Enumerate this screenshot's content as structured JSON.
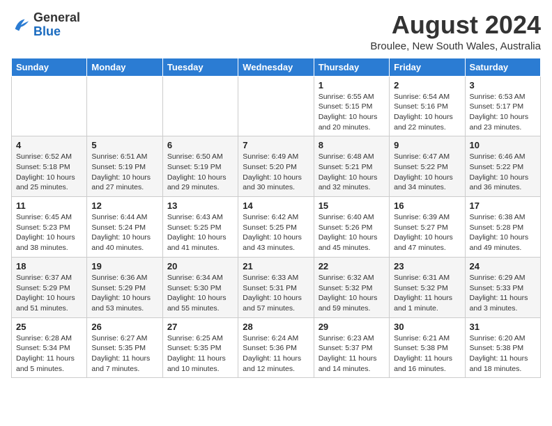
{
  "header": {
    "logo_general": "General",
    "logo_blue": "Blue",
    "month_title": "August 2024",
    "location": "Broulee, New South Wales, Australia"
  },
  "days_of_week": [
    "Sunday",
    "Monday",
    "Tuesday",
    "Wednesday",
    "Thursday",
    "Friday",
    "Saturday"
  ],
  "weeks": [
    [
      {
        "day": "",
        "info": ""
      },
      {
        "day": "",
        "info": ""
      },
      {
        "day": "",
        "info": ""
      },
      {
        "day": "",
        "info": ""
      },
      {
        "day": "1",
        "info": "Sunrise: 6:55 AM\nSunset: 5:15 PM\nDaylight: 10 hours\nand 20 minutes."
      },
      {
        "day": "2",
        "info": "Sunrise: 6:54 AM\nSunset: 5:16 PM\nDaylight: 10 hours\nand 22 minutes."
      },
      {
        "day": "3",
        "info": "Sunrise: 6:53 AM\nSunset: 5:17 PM\nDaylight: 10 hours\nand 23 minutes."
      }
    ],
    [
      {
        "day": "4",
        "info": "Sunrise: 6:52 AM\nSunset: 5:18 PM\nDaylight: 10 hours\nand 25 minutes."
      },
      {
        "day": "5",
        "info": "Sunrise: 6:51 AM\nSunset: 5:19 PM\nDaylight: 10 hours\nand 27 minutes."
      },
      {
        "day": "6",
        "info": "Sunrise: 6:50 AM\nSunset: 5:19 PM\nDaylight: 10 hours\nand 29 minutes."
      },
      {
        "day": "7",
        "info": "Sunrise: 6:49 AM\nSunset: 5:20 PM\nDaylight: 10 hours\nand 30 minutes."
      },
      {
        "day": "8",
        "info": "Sunrise: 6:48 AM\nSunset: 5:21 PM\nDaylight: 10 hours\nand 32 minutes."
      },
      {
        "day": "9",
        "info": "Sunrise: 6:47 AM\nSunset: 5:22 PM\nDaylight: 10 hours\nand 34 minutes."
      },
      {
        "day": "10",
        "info": "Sunrise: 6:46 AM\nSunset: 5:22 PM\nDaylight: 10 hours\nand 36 minutes."
      }
    ],
    [
      {
        "day": "11",
        "info": "Sunrise: 6:45 AM\nSunset: 5:23 PM\nDaylight: 10 hours\nand 38 minutes."
      },
      {
        "day": "12",
        "info": "Sunrise: 6:44 AM\nSunset: 5:24 PM\nDaylight: 10 hours\nand 40 minutes."
      },
      {
        "day": "13",
        "info": "Sunrise: 6:43 AM\nSunset: 5:25 PM\nDaylight: 10 hours\nand 41 minutes."
      },
      {
        "day": "14",
        "info": "Sunrise: 6:42 AM\nSunset: 5:25 PM\nDaylight: 10 hours\nand 43 minutes."
      },
      {
        "day": "15",
        "info": "Sunrise: 6:40 AM\nSunset: 5:26 PM\nDaylight: 10 hours\nand 45 minutes."
      },
      {
        "day": "16",
        "info": "Sunrise: 6:39 AM\nSunset: 5:27 PM\nDaylight: 10 hours\nand 47 minutes."
      },
      {
        "day": "17",
        "info": "Sunrise: 6:38 AM\nSunset: 5:28 PM\nDaylight: 10 hours\nand 49 minutes."
      }
    ],
    [
      {
        "day": "18",
        "info": "Sunrise: 6:37 AM\nSunset: 5:29 PM\nDaylight: 10 hours\nand 51 minutes."
      },
      {
        "day": "19",
        "info": "Sunrise: 6:36 AM\nSunset: 5:29 PM\nDaylight: 10 hours\nand 53 minutes."
      },
      {
        "day": "20",
        "info": "Sunrise: 6:34 AM\nSunset: 5:30 PM\nDaylight: 10 hours\nand 55 minutes."
      },
      {
        "day": "21",
        "info": "Sunrise: 6:33 AM\nSunset: 5:31 PM\nDaylight: 10 hours\nand 57 minutes."
      },
      {
        "day": "22",
        "info": "Sunrise: 6:32 AM\nSunset: 5:32 PM\nDaylight: 10 hours\nand 59 minutes."
      },
      {
        "day": "23",
        "info": "Sunrise: 6:31 AM\nSunset: 5:32 PM\nDaylight: 11 hours\nand 1 minute."
      },
      {
        "day": "24",
        "info": "Sunrise: 6:29 AM\nSunset: 5:33 PM\nDaylight: 11 hours\nand 3 minutes."
      }
    ],
    [
      {
        "day": "25",
        "info": "Sunrise: 6:28 AM\nSunset: 5:34 PM\nDaylight: 11 hours\nand 5 minutes."
      },
      {
        "day": "26",
        "info": "Sunrise: 6:27 AM\nSunset: 5:35 PM\nDaylight: 11 hours\nand 7 minutes."
      },
      {
        "day": "27",
        "info": "Sunrise: 6:25 AM\nSunset: 5:35 PM\nDaylight: 11 hours\nand 10 minutes."
      },
      {
        "day": "28",
        "info": "Sunrise: 6:24 AM\nSunset: 5:36 PM\nDaylight: 11 hours\nand 12 minutes."
      },
      {
        "day": "29",
        "info": "Sunrise: 6:23 AM\nSunset: 5:37 PM\nDaylight: 11 hours\nand 14 minutes."
      },
      {
        "day": "30",
        "info": "Sunrise: 6:21 AM\nSunset: 5:38 PM\nDaylight: 11 hours\nand 16 minutes."
      },
      {
        "day": "31",
        "info": "Sunrise: 6:20 AM\nSunset: 5:38 PM\nDaylight: 11 hours\nand 18 minutes."
      }
    ]
  ]
}
